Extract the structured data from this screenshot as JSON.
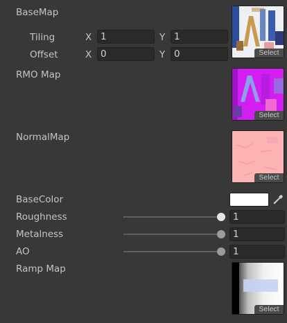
{
  "base_map": {
    "label": "BaseMap",
    "select_label": "Select",
    "tiling": {
      "label": "Tiling",
      "x_label": "X",
      "x_value": "1",
      "y_label": "Y",
      "y_value": "1"
    },
    "offset": {
      "label": "Offset",
      "x_label": "X",
      "x_value": "0",
      "y_label": "Y",
      "y_value": "0"
    }
  },
  "rmo_map": {
    "label": "RMO Map",
    "select_label": "Select"
  },
  "normal_map": {
    "label": "NormalMap",
    "select_label": "Select"
  },
  "base_color": {
    "label": "BaseColor",
    "value": "#ffffff"
  },
  "roughness": {
    "label": "Roughness",
    "value": "1",
    "fraction": 1
  },
  "metalness": {
    "label": "Metalness",
    "value": "1",
    "fraction": 1
  },
  "ao": {
    "label": "AO",
    "value": "1",
    "fraction": 1
  },
  "ramp_map": {
    "label": "Ramp Map",
    "select_label": "Select"
  },
  "colors": {
    "background": "#383838",
    "field": "#2a2a2a",
    "rmo_tint": "#d21ef0",
    "normal_tint": "#ffb4b4"
  }
}
